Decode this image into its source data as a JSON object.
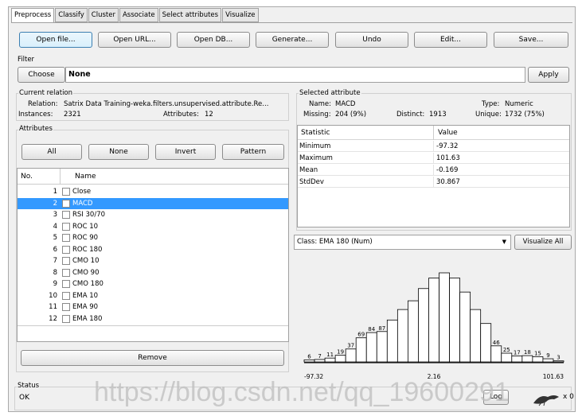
{
  "tabs": [
    "Preprocess",
    "Classify",
    "Cluster",
    "Associate",
    "Select attributes",
    "Visualize"
  ],
  "toolbar": {
    "open_file": "Open file...",
    "open_url": "Open URL...",
    "open_db": "Open DB...",
    "generate": "Generate...",
    "undo": "Undo",
    "edit": "Edit...",
    "save": "Save..."
  },
  "filter": {
    "label": "Filter",
    "choose": "Choose",
    "value": "None",
    "apply": "Apply"
  },
  "relation": {
    "group_label": "Current relation",
    "relation_label": "Relation:",
    "relation_value": "Satrix Data Training-weka.filters.unsupervised.attribute.Re...",
    "instances_label": "Instances:",
    "instances_value": "2321",
    "attributes_label": "Attributes:",
    "attributes_value": "12"
  },
  "attributes": {
    "group_label": "Attributes",
    "all": "All",
    "none": "None",
    "invert": "Invert",
    "pattern": "Pattern",
    "col_no": "No.",
    "col_name": "Name",
    "items": [
      {
        "no": "1",
        "name": "Close"
      },
      {
        "no": "2",
        "name": "MACD"
      },
      {
        "no": "3",
        "name": "RSI 30/70"
      },
      {
        "no": "4",
        "name": "ROC 10"
      },
      {
        "no": "5",
        "name": "ROC 90"
      },
      {
        "no": "6",
        "name": "ROC 180"
      },
      {
        "no": "7",
        "name": "CMO 10"
      },
      {
        "no": "8",
        "name": "CMO 90"
      },
      {
        "no": "9",
        "name": "CMO 180"
      },
      {
        "no": "10",
        "name": "EMA 10"
      },
      {
        "no": "11",
        "name": "EMA 90"
      },
      {
        "no": "12",
        "name": "EMA 180"
      }
    ],
    "remove": "Remove"
  },
  "selected": {
    "group_label": "Selected attribute",
    "name_label": "Name:",
    "name_value": "MACD",
    "type_label": "Type:",
    "type_value": "Numeric",
    "missing_label": "Missing:",
    "missing_value": "204 (9%)",
    "distinct_label": "Distinct:",
    "distinct_value": "1913",
    "unique_label": "Unique:",
    "unique_value": "1732 (75%)",
    "col_stat": "Statistic",
    "col_value": "Value",
    "stats": [
      {
        "stat": "Minimum",
        "value": "-97.32"
      },
      {
        "stat": "Maximum",
        "value": "101.63"
      },
      {
        "stat": "Mean",
        "value": "-0.169"
      },
      {
        "stat": "StdDev",
        "value": "30.867"
      }
    ]
  },
  "class_select": {
    "value": "Class: EMA 180 (Num)",
    "visualize_all": "Visualize All"
  },
  "status": {
    "label": "Status",
    "value": "OK",
    "log_button": "Log",
    "x_count": "x 0"
  },
  "watermark": "https://blog.csdn.net/qq_19600291",
  "chart_data": {
    "type": "bar",
    "title": "",
    "xlabel": "",
    "ylabel": "",
    "x_min_label": "-97.32",
    "x_mid_label": "2.16",
    "x_max_label": "101.63",
    "values": [
      6,
      7,
      11,
      19,
      37,
      69,
      84,
      87,
      120,
      150,
      175,
      210,
      240,
      255,
      240,
      200,
      150,
      110,
      46,
      25,
      17,
      18,
      15,
      9,
      3
    ],
    "data_labels": [
      "6",
      "7",
      "11",
      "19",
      "37",
      "69",
      "84",
      "87",
      "",
      "",
      "",
      "",
      "",
      "",
      "",
      "",
      "",
      "",
      "46",
      "25",
      "17",
      "18",
      "15",
      "9",
      "3"
    ],
    "bar_color": "#ffffff"
  }
}
